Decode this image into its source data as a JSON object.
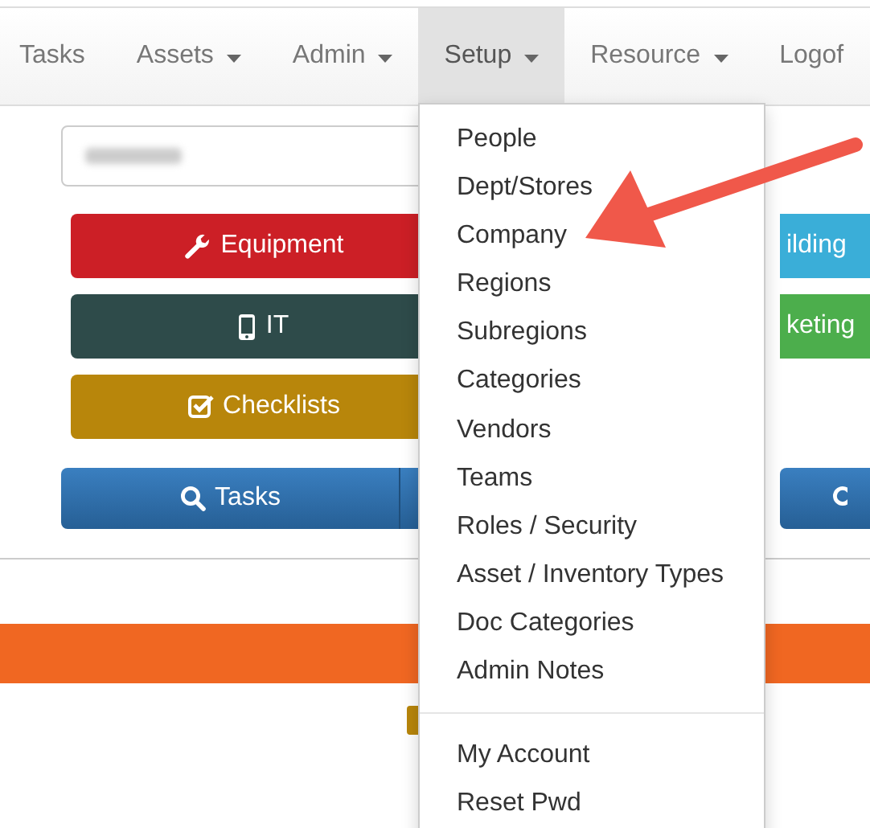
{
  "nav": [
    {
      "label": "Tasks",
      "has_menu": false,
      "selected": false
    },
    {
      "label": "Assets",
      "has_menu": true,
      "selected": false
    },
    {
      "label": "Admin",
      "has_menu": true,
      "selected": false
    },
    {
      "label": "Setup",
      "has_menu": true,
      "selected": true
    },
    {
      "label": "Resource",
      "has_menu": true,
      "selected": false
    },
    {
      "label": "Logof",
      "has_menu": false,
      "selected": false
    }
  ],
  "left_buttons": [
    {
      "label": "Equipment",
      "kind": "equipment",
      "color": "#cc1f26"
    },
    {
      "label": "IT",
      "kind": "it",
      "color": "#2e4b4a"
    },
    {
      "label": "Checklists",
      "kind": "checklists",
      "color": "#b8860b"
    }
  ],
  "right_buttons": [
    {
      "label": "ilding",
      "color": "#3aaed8"
    },
    {
      "label": "keting",
      "color": "#4cae4c"
    }
  ],
  "search_button": {
    "label": "Tasks"
  },
  "dropdown": {
    "groups": [
      [
        "People",
        "Dept/Stores",
        "Company",
        "Regions",
        "Subregions",
        "Categories",
        "Vendors",
        "Teams",
        "Roles / Security",
        "Asset / Inventory Types",
        "Doc Categories",
        "Admin Notes"
      ],
      [
        "My Account",
        "Reset Pwd"
      ]
    ]
  }
}
